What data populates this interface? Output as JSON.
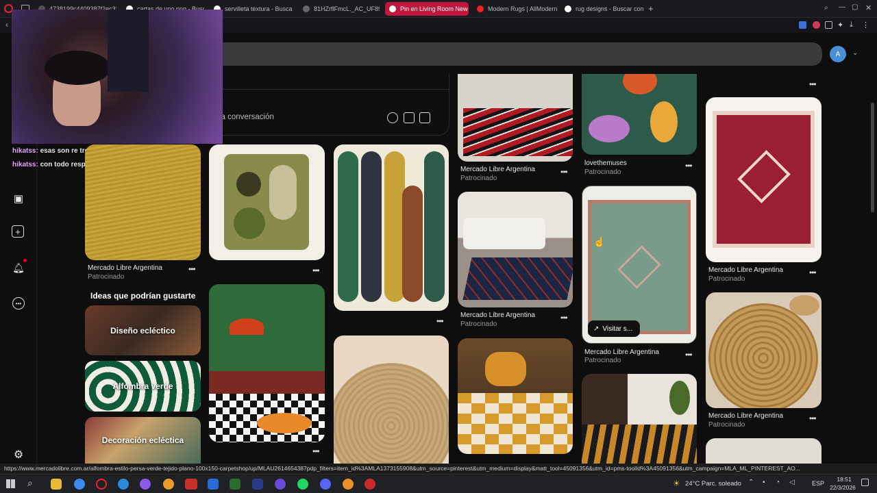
{
  "browser": {
    "tabs": [
      {
        "label": "4738199c4409387f2ec33...",
        "active": false
      },
      {
        "label": "cartas de uno png - Busc",
        "active": false
      },
      {
        "label": "servilleta textura - Busca",
        "active": false
      },
      {
        "label": "81HZrflFmcL._AC_UF894,",
        "active": false
      },
      {
        "label": "Pin en Living Room New",
        "active": true
      },
      {
        "label": "Modern Rugs | AllModern",
        "active": false
      },
      {
        "label": "rug designs - Buscar con",
        "active": false
      }
    ],
    "new_tab": "+"
  },
  "header": {
    "avatar_letter": "A"
  },
  "comment_box": {
    "placeholder": "la conversación"
  },
  "chat": [
    {
      "user": "hikatss:",
      "text": "esas son re treintanero igual"
    },
    {
      "user": "hikatss:",
      "text": "con todo respeto a te lo rezurdo asi nomarx"
    }
  ],
  "pins": {
    "col1": {
      "source": "Mercado Libre Argentina",
      "sub": "Patrocinado"
    },
    "c4a": {
      "source": "Mercado Libre Argentina",
      "sub": "Patrocinado"
    },
    "c4b": {
      "source": "Mercado Libre Argentina",
      "sub": "Patrocinado"
    },
    "c5a": {
      "source": "lovethemuses",
      "sub": "Patrocinado"
    },
    "c5b": {
      "source": "Mercado Libre Argentina",
      "sub": "Patrocinado",
      "visit": "Visitar s..."
    },
    "c6a": {
      "source": "Mercado Libre Argentina",
      "sub": "Patrocinado"
    },
    "c6b": {
      "source": "Mercado Libre Argentina",
      "sub": "Patrocinado"
    }
  },
  "ideas": {
    "heading": "Ideas que podrían gustarte",
    "items": [
      "Diseño ecléctico",
      "Alfombra verde",
      "Decoración ecléctica"
    ]
  },
  "status_url": "https://www.mercadolibre.com.ar/alfombra-estilo-persa-verde-tejido-plano-100x150-carpetshop/up/MLAU2614654387pdp_filters=item_id%3AMLA1373155908&utm_source=pinterest&utm_medium=display&matt_tool=45091356&utm_id=pms-toolId%3A45091356&utm_campaign=MLA_ML_PINTEREST_AO...",
  "taskbar": {
    "weather": "24°C  Parc. soleado",
    "lang": "ESP",
    "time": "18:51",
    "date": "22/3/2026"
  },
  "colors": {
    "active_tab": "#c0173f",
    "chat_user": "#e7a7ff"
  }
}
